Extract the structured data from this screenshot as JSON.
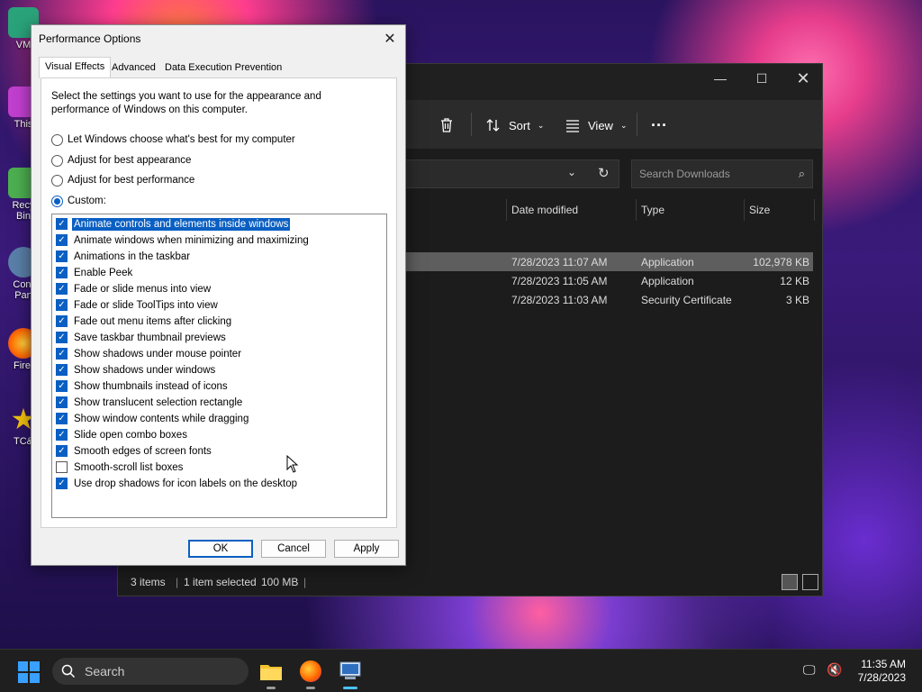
{
  "desktop": {
    "icons": [
      {
        "label": "VM"
      },
      {
        "label": "This"
      },
      {
        "label": "Recy Bin"
      },
      {
        "label": "Cont Pan"
      },
      {
        "label": "Firef"
      },
      {
        "label": "TC&"
      }
    ]
  },
  "explorer": {
    "toolbar": {
      "sort_label": "Sort",
      "view_label": "View"
    },
    "search_placeholder": "Search Downloads",
    "columns": [
      "Date modified",
      "Type",
      "Size"
    ],
    "files": [
      {
        "date": "7/28/2023 11:07 AM",
        "type": "Application",
        "size": "102,978 KB",
        "selected": true
      },
      {
        "date": "7/28/2023 11:05 AM",
        "type": "Application",
        "size": "12 KB",
        "selected": false
      },
      {
        "date": "7/28/2023 11:03 AM",
        "type": "Security Certificate",
        "size": "3 KB",
        "selected": false
      }
    ],
    "status": {
      "items": "3 items",
      "selected": "1 item selected",
      "size": "100 MB"
    }
  },
  "dialog": {
    "title": "Performance Options",
    "tabs": [
      "Visual Effects",
      "Advanced",
      "Data Execution Prevention"
    ],
    "description": "Select the settings you want to use for the appearance and performance of Windows on this computer.",
    "radios": [
      {
        "label": "Let Windows choose what's best for my computer",
        "checked": false
      },
      {
        "label": "Adjust for best appearance",
        "checked": false
      },
      {
        "label": "Adjust for best performance",
        "checked": false
      },
      {
        "label": "Custom:",
        "checked": true
      }
    ],
    "options": [
      {
        "label": "Animate controls and elements inside windows",
        "checked": true,
        "focused": true
      },
      {
        "label": "Animate windows when minimizing and maximizing",
        "checked": true
      },
      {
        "label": "Animations in the taskbar",
        "checked": true
      },
      {
        "label": "Enable Peek",
        "checked": true
      },
      {
        "label": "Fade or slide menus into view",
        "checked": true
      },
      {
        "label": "Fade or slide ToolTips into view",
        "checked": true
      },
      {
        "label": "Fade out menu items after clicking",
        "checked": true
      },
      {
        "label": "Save taskbar thumbnail previews",
        "checked": true
      },
      {
        "label": "Show shadows under mouse pointer",
        "checked": true
      },
      {
        "label": "Show shadows under windows",
        "checked": true
      },
      {
        "label": "Show thumbnails instead of icons",
        "checked": true
      },
      {
        "label": "Show translucent selection rectangle",
        "checked": true
      },
      {
        "label": "Show window contents while dragging",
        "checked": true
      },
      {
        "label": "Slide open combo boxes",
        "checked": true
      },
      {
        "label": "Smooth edges of screen fonts",
        "checked": true
      },
      {
        "label": "Smooth-scroll list boxes",
        "checked": false
      },
      {
        "label": "Use drop shadows for icon labels on the desktop",
        "checked": true
      }
    ],
    "buttons": {
      "ok": "OK",
      "cancel": "Cancel",
      "apply": "Apply"
    }
  },
  "taskbar": {
    "search_label": "Search",
    "time": "11:35 AM",
    "date": "7/28/2023"
  },
  "colors": {
    "accent": "#0a5fc2",
    "explorer_bg": "#1c1c1c"
  }
}
